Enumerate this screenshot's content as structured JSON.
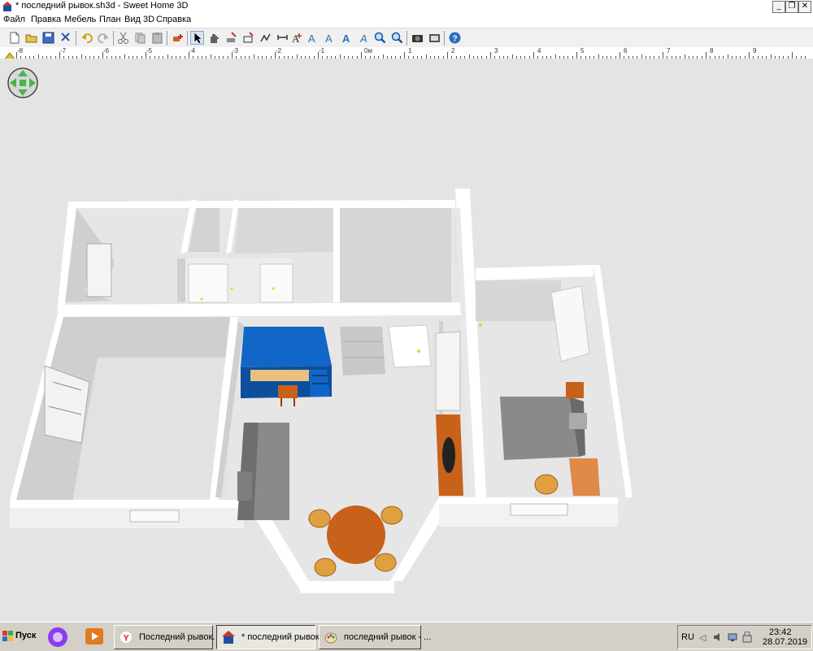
{
  "window": {
    "title": "* последний рывок.sh3d - Sweet Home 3D",
    "controls": {
      "minimize": "_",
      "maximize": "❐",
      "close": "✕"
    }
  },
  "menu": {
    "items": [
      "Файл",
      "Правка",
      "Мебель",
      "План",
      "Вид 3D",
      "Справка"
    ]
  },
  "toolbar": {
    "buttons": [
      "new-file-icon",
      "open-file-icon",
      "save-icon",
      "cut-tool-icon",
      "undo-icon",
      "redo-icon",
      "cut-icon",
      "copy-icon",
      "paste-icon",
      "add-furniture-icon",
      "select-arrow-icon",
      "pan-hand-icon",
      "create-walls-icon",
      "create-rooms-icon",
      "create-polylines-icon",
      "create-dimensions-icon",
      "add-text-icon",
      "zoom-in-icon",
      "zoom-out-icon",
      "photo-camera-icon",
      "video-camera-icon",
      "help-icon"
    ]
  },
  "ruler": {
    "labels": [
      "-8",
      "-7",
      "-6",
      "-5",
      "-4",
      "-3",
      "-2",
      "-1",
      "0м",
      "1",
      "2",
      "3",
      "4",
      "5",
      "6",
      "7",
      "8",
      "9"
    ]
  },
  "navigator": {
    "icon": "navigation-arrows-icon"
  },
  "taskbar": {
    "start_label": "Пуск",
    "items": [
      {
        "label": "Последний рывок. ...",
        "icon": "yandex-browser-icon"
      },
      {
        "label": "* последний рывок....",
        "icon": "sweet-home-3d-icon"
      },
      {
        "label": "последний рывок - ...",
        "icon": "paint-icon"
      }
    ],
    "tray": {
      "language": "RU",
      "time": "23:42",
      "date": "28.07.2019"
    }
  },
  "colors": {
    "floor": "#e4e4e4",
    "wall_top": "#ffffff",
    "wall_side": "#c9c9c9",
    "bed_blue": "#1166c8",
    "table_orange": "#c8621b",
    "chair_orange": "#e0a040",
    "sofa_gray": "#8a8a8a"
  }
}
